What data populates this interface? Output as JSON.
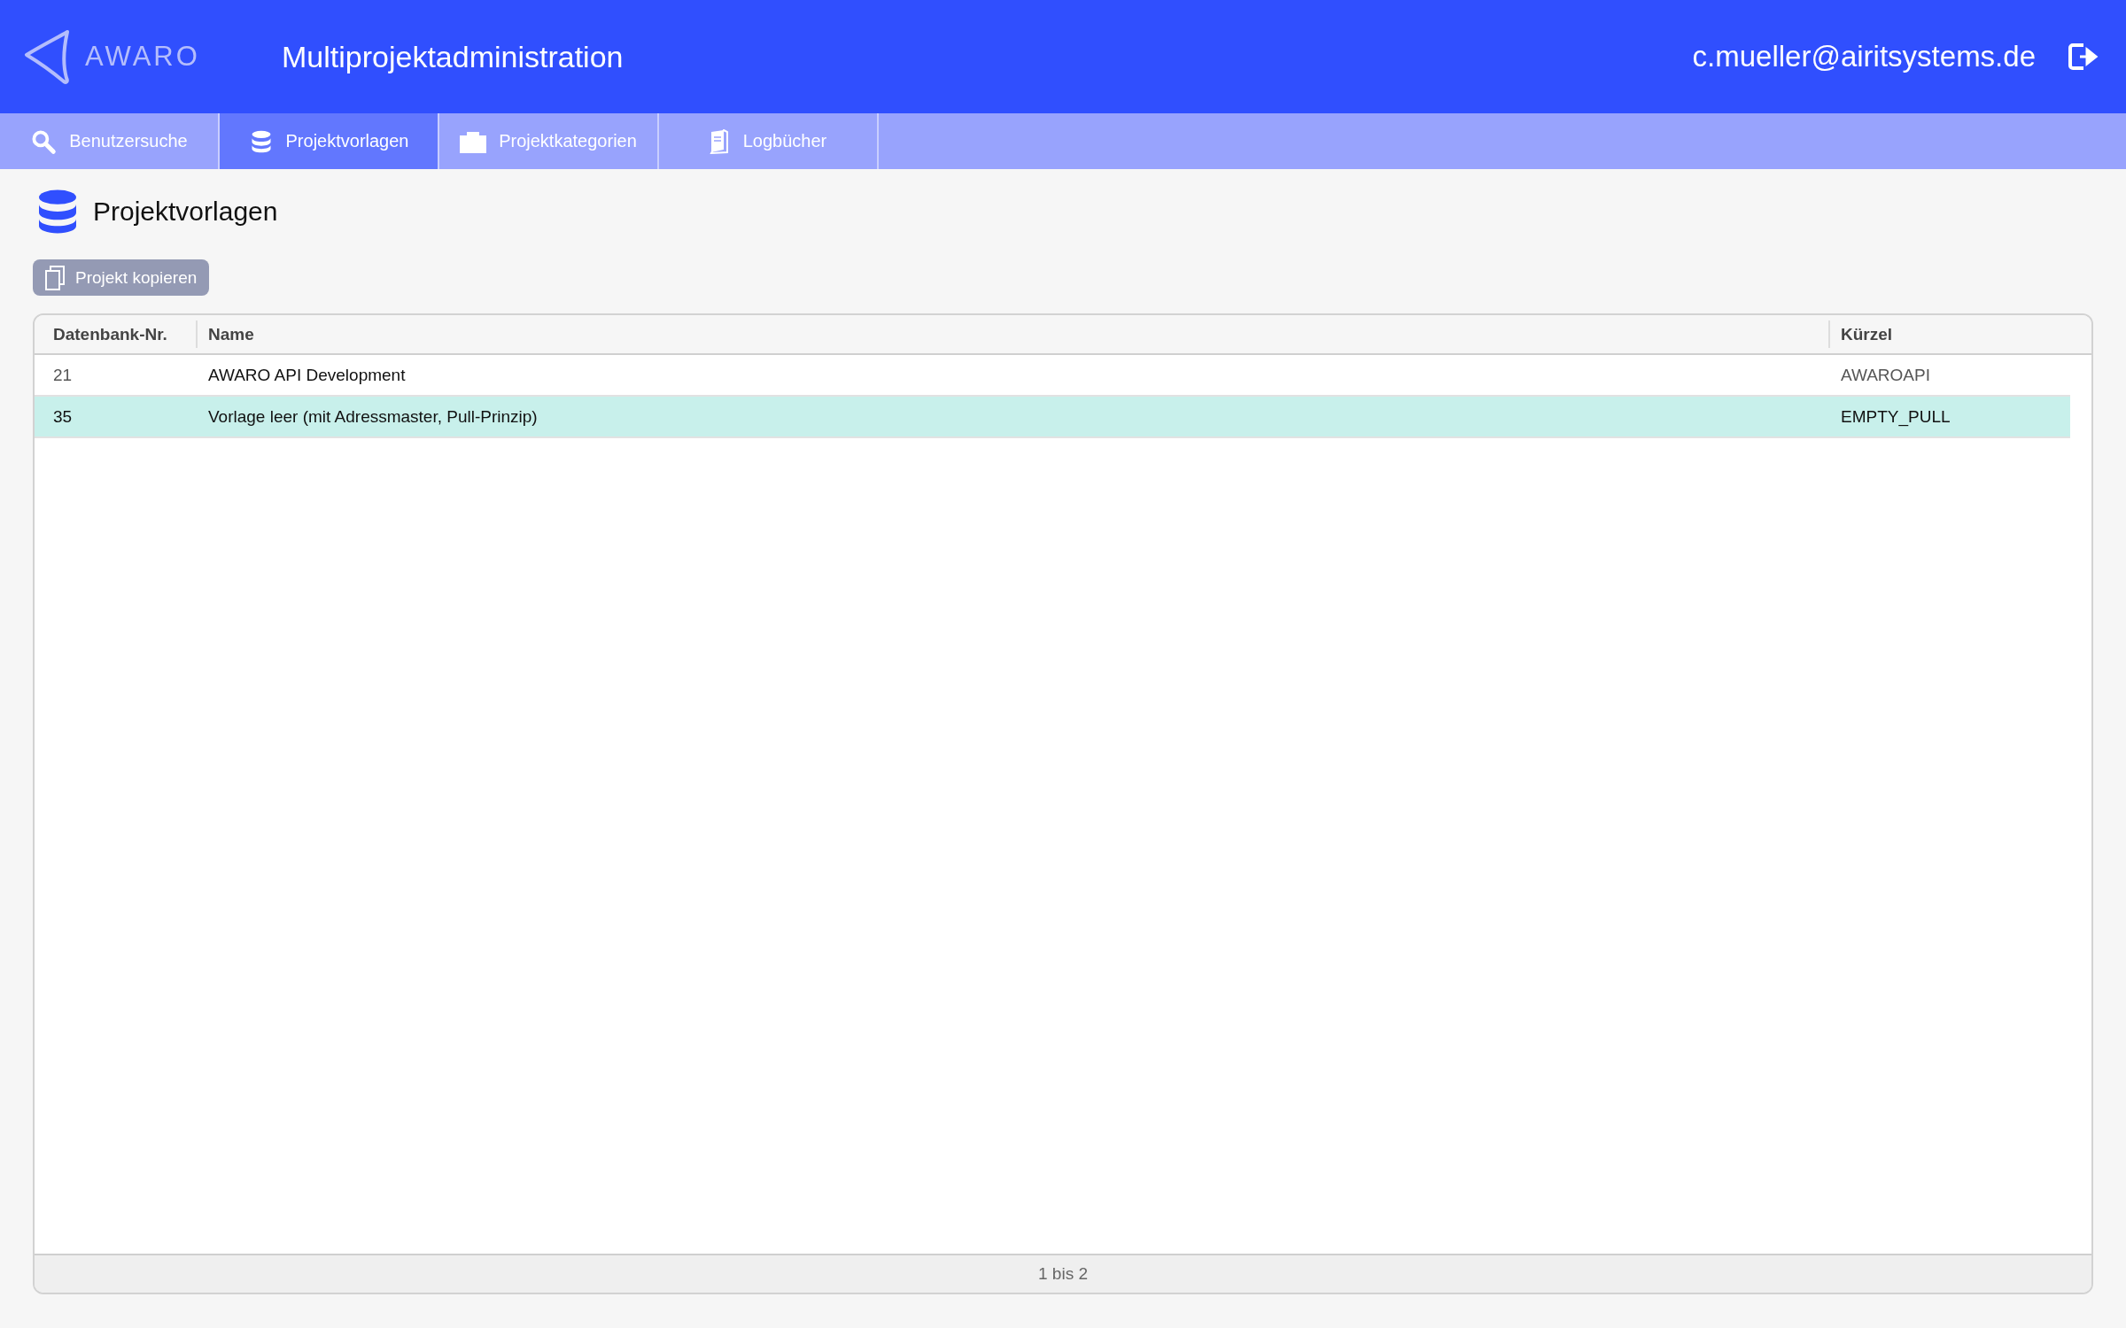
{
  "header": {
    "logo_text": "AWARO",
    "title": "Multiprojektadministration",
    "user": "c.mueller@airitsystems.de"
  },
  "tabs": [
    {
      "label": "Benutzersuche",
      "selected": false
    },
    {
      "label": "Projektvorlagen",
      "selected": true
    },
    {
      "label": "Projektkategorien",
      "selected": false
    },
    {
      "label": "Logbücher",
      "selected": false
    }
  ],
  "page": {
    "title": "Projektvorlagen",
    "copy_button": "Projekt kopieren"
  },
  "table": {
    "columns": [
      "Datenbank-Nr.",
      "Name",
      "Kürzel"
    ],
    "rows": [
      {
        "cells": [
          "21",
          "AWARO API Development",
          "AWAROAPI"
        ],
        "selected": false
      },
      {
        "cells": [
          "35",
          "Vorlage leer (mit Adressmaster, Pull-Prinzip)",
          "EMPTY_PULL"
        ],
        "selected": true
      }
    ],
    "footer": "1 bis 2"
  }
}
